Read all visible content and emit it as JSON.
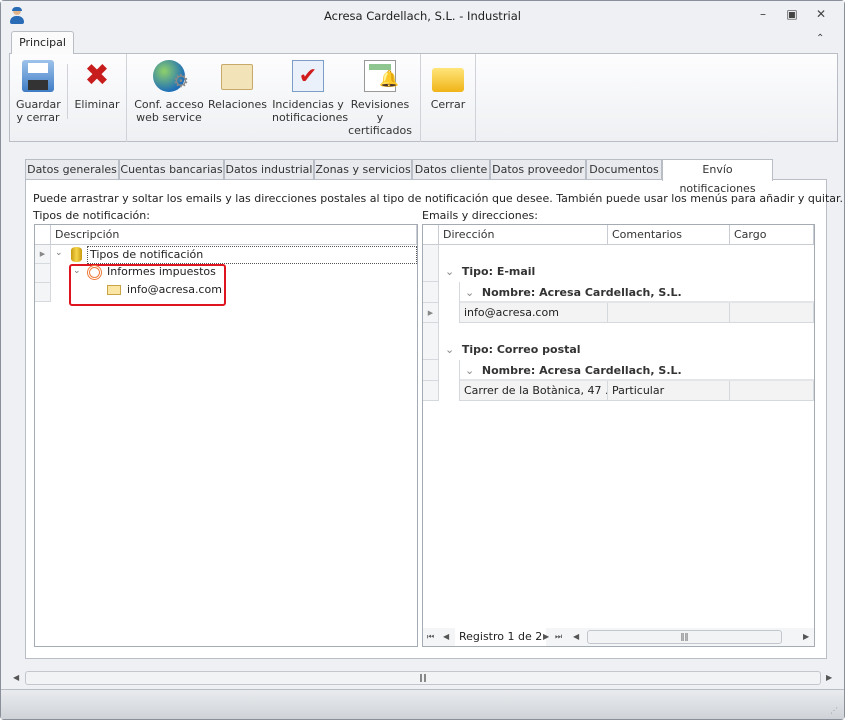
{
  "window": {
    "title": "Acresa Cardellach, S.L. - Industrial",
    "minimize": "–",
    "restore": "▣",
    "close": "✕",
    "collapse_ribbon": "⌃"
  },
  "ribbon": {
    "tab": "Principal",
    "buttons": [
      {
        "l1": "Guardar",
        "l2": "y cerrar",
        "icon": "save-icon"
      },
      {
        "l1": "Eliminar",
        "l2": "",
        "icon": "delete-icon"
      },
      {
        "l1": "Conf. acceso",
        "l2": "web service",
        "icon": "globe-gear-icon"
      },
      {
        "l1": "Relaciones",
        "l2": "",
        "icon": "contacts-card-icon"
      },
      {
        "l1": "Incidencias y",
        "l2": "notificaciones",
        "icon": "clipboard-check-icon"
      },
      {
        "l1": "Revisiones y",
        "l2": "certificados",
        "icon": "document-bell-icon"
      },
      {
        "l1": "Cerrar",
        "l2": "",
        "icon": "folder-exit-icon"
      }
    ]
  },
  "tabs": [
    "Datos generales",
    "Cuentas bancarias",
    "Datos industrial",
    "Zonas y servicios",
    "Datos cliente",
    "Datos proveedor",
    "Documentos",
    "Envío notificaciones"
  ],
  "active_tab": "Envío notificaciones",
  "instructions": "Puede arrastrar y soltar los emails y las direcciones postales al tipo de notificación que desee. También puede usar los menús para añadir y quitar.",
  "left": {
    "label": "Tipos de notificación:",
    "column": "Descripción",
    "tree": {
      "root": "Tipos de notificación",
      "child": "Informes impuestos",
      "leaf": "info@acresa.com"
    }
  },
  "right": {
    "label": "Emails y direcciones:",
    "columns": [
      "Dirección",
      "Comentarios",
      "Cargo"
    ],
    "groups": [
      {
        "tipo": "Tipo: E-mail",
        "nombre": "Nombre: Acresa Cardellach, S.L.",
        "row": {
          "direccion": "info@acresa.com",
          "comentarios": "",
          "cargo": ""
        }
      },
      {
        "tipo": "Tipo: Correo postal",
        "nombre": "Nombre: Acresa Cardellach, S.L.",
        "row": {
          "direccion": "Carrer de la Botànica, 47 ...",
          "comentarios": "Particular",
          "cargo": ""
        }
      }
    ],
    "navigator": "Registro 1 de 2"
  },
  "colors": {
    "highlight": "#e0141e"
  }
}
